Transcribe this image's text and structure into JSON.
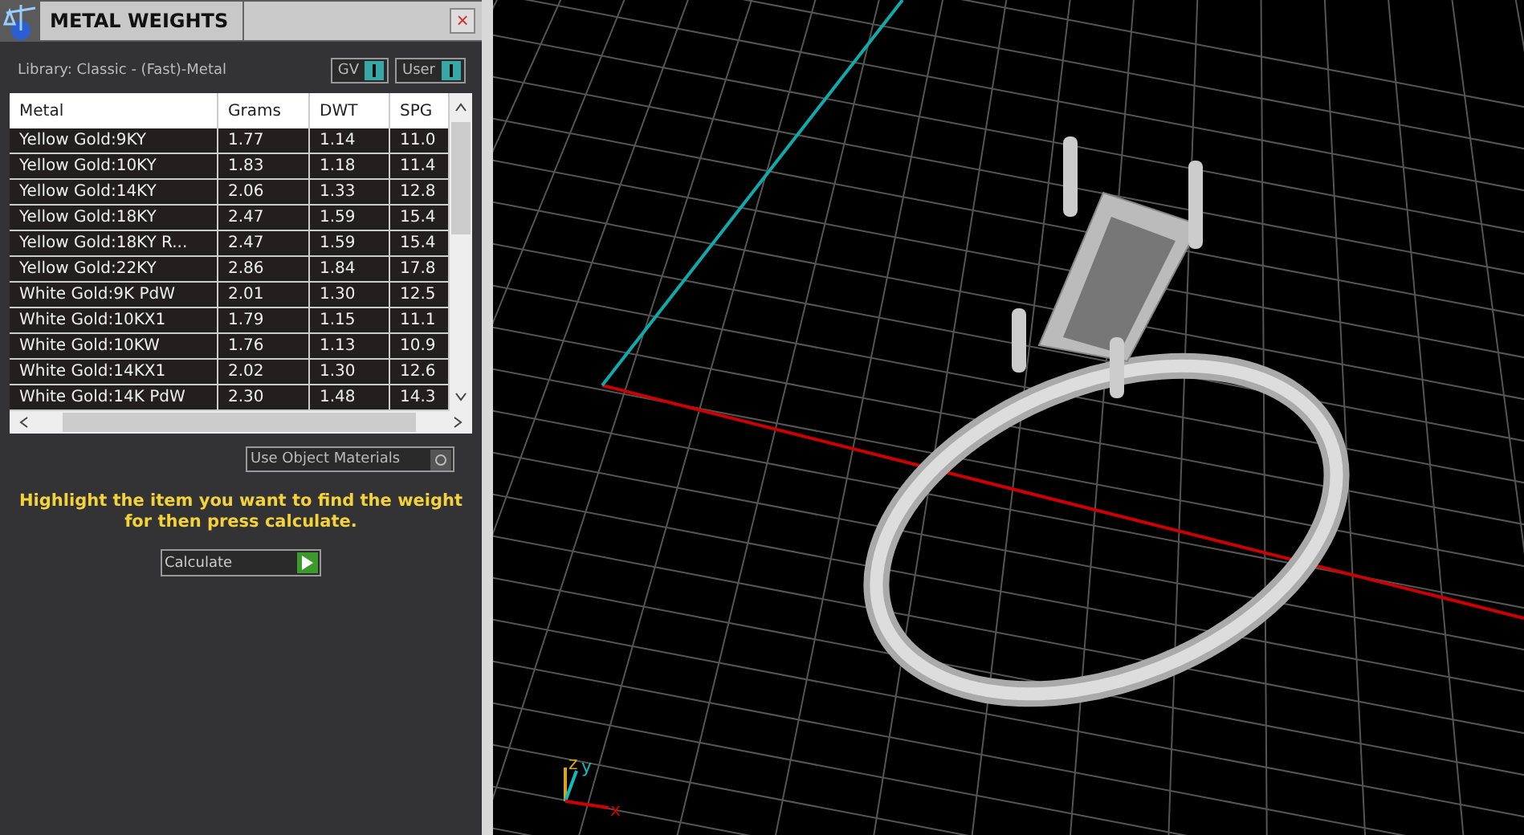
{
  "panel": {
    "title": "METAL WEIGHTS",
    "close": "×",
    "library": "Library: Classic - (Fast)-Metal",
    "toggles": [
      {
        "label": "GV",
        "on": true
      },
      {
        "label": "User",
        "on": true
      }
    ]
  },
  "table": {
    "columns": [
      "Metal",
      "Grams",
      "DWT",
      "SPG"
    ],
    "rows": [
      [
        "Yellow Gold:9KY",
        "1.77",
        "1.14",
        "11.0"
      ],
      [
        "Yellow Gold:10KY",
        "1.83",
        "1.18",
        "11.4"
      ],
      [
        "Yellow Gold:14KY",
        "2.06",
        "1.33",
        "12.8"
      ],
      [
        "Yellow Gold:18KY",
        "2.47",
        "1.59",
        "15.4"
      ],
      [
        "Yellow Gold:18KY R...",
        "2.47",
        "1.59",
        "15.4"
      ],
      [
        "Yellow Gold:22KY",
        "2.86",
        "1.84",
        "17.8"
      ],
      [
        "White Gold:9K PdW",
        "2.01",
        "1.30",
        "12.5"
      ],
      [
        "White Gold:10KX1",
        "1.79",
        "1.15",
        "11.1"
      ],
      [
        "White Gold:10KW",
        "1.76",
        "1.13",
        "10.9"
      ],
      [
        "White Gold:14KX1",
        "2.02",
        "1.30",
        "12.6"
      ],
      [
        "White Gold:14K PdW",
        "2.30",
        "1.48",
        "14.3"
      ]
    ]
  },
  "use_object_materials": {
    "label": "Use Object Materials",
    "checked": false
  },
  "hint": "Highlight the item you want to find the weight for then press calculate.",
  "calculate_button": "Calculate",
  "viewport": {
    "axes": [
      "z",
      "y",
      "x"
    ]
  }
}
